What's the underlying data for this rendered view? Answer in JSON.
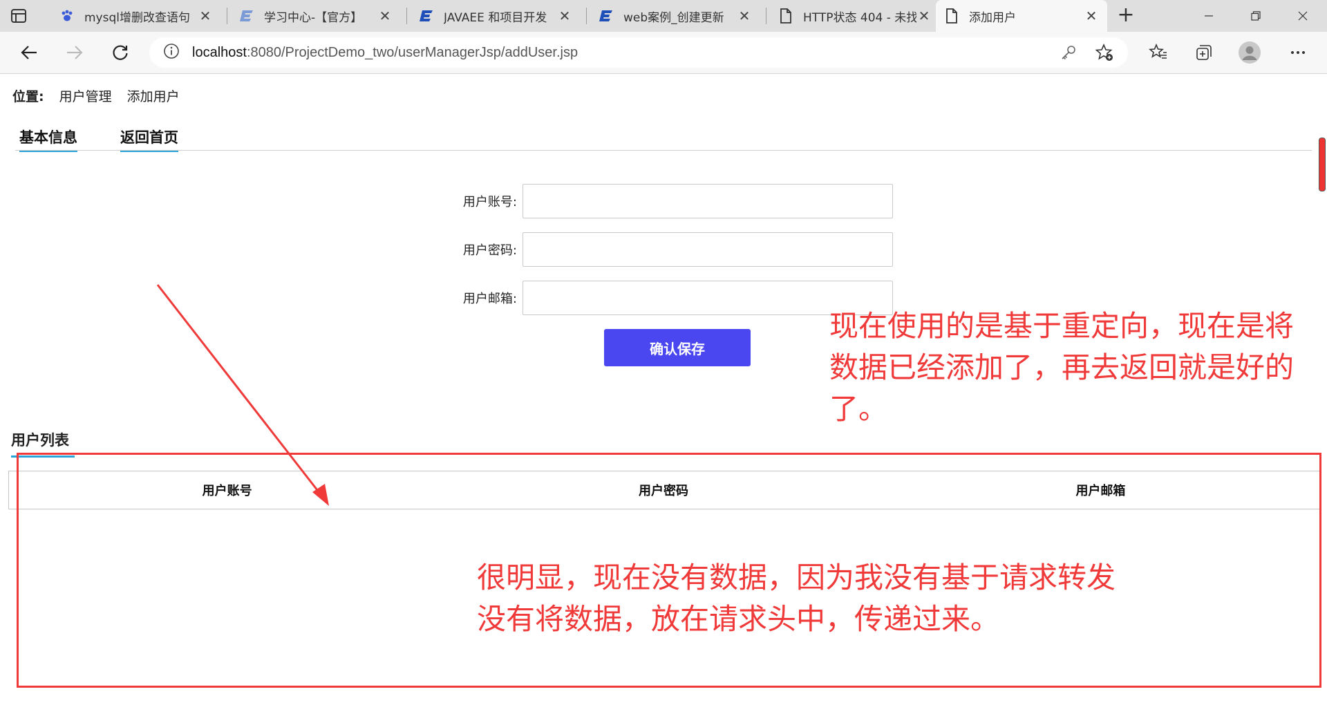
{
  "browser": {
    "tabs": [
      {
        "title": "mysql增删改查语句",
        "icon": "paw-icon"
      },
      {
        "title": "学习中心-【官方】",
        "icon": "site-e-icon"
      },
      {
        "title": "JAVAEE 和项目开发",
        "icon": "site-e-icon"
      },
      {
        "title": "web案例_创建更新",
        "icon": "site-e-icon"
      },
      {
        "title": "HTTP状态 404 - 未找",
        "icon": "page-icon"
      },
      {
        "title": "添加用户",
        "icon": "page-icon",
        "active": true
      }
    ],
    "url_host": "localhost",
    "url_rest": ":8080/ProjectDemo_two/userManagerJsp/addUser.jsp"
  },
  "breadcrumb": {
    "label": "位置:",
    "items": [
      "用户管理",
      "添加用户"
    ]
  },
  "form_tabs": [
    "基本信息",
    "返回首页"
  ],
  "form": {
    "fields": [
      {
        "label": "用户账号:",
        "value": ""
      },
      {
        "label": "用户密码:",
        "value": ""
      },
      {
        "label": "用户邮箱:",
        "value": ""
      }
    ],
    "save_label": "确认保存"
  },
  "user_list": {
    "title": "用户列表",
    "columns": [
      "用户账号",
      "用户密码",
      "用户邮箱"
    ],
    "rows": []
  },
  "annotations": {
    "note1": "现在使用的是基于重定向，现在是将数据已经添加了，再去返回就是好的了。",
    "note2_line1": "很明显，现在没有数据，因为我没有基于请求转发",
    "note2_line2": "没有将数据，放在请求头中，传递过来。",
    "color": "#f03a3a"
  },
  "theme": {
    "accent": "#2aa3d8",
    "button": "#4a46f0"
  }
}
